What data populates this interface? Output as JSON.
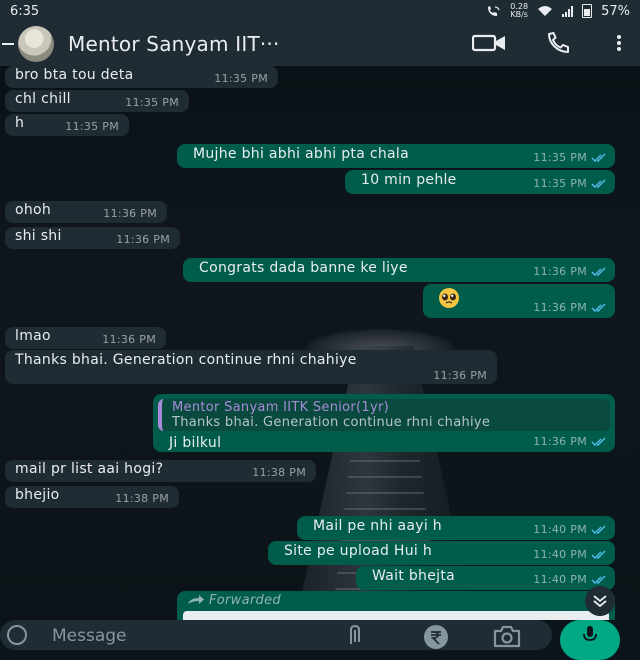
{
  "status_bar": {
    "time": "6:35",
    "net_speed_value": "0.28",
    "net_speed_unit": "KB/s",
    "battery": "57%"
  },
  "header": {
    "contact_name": "Mentor Sanyam IIT···"
  },
  "messages": [
    {
      "text": "bro bta tou deta",
      "time": "11:35 PM"
    },
    {
      "text": "chl chill",
      "time": "11:35 PM"
    },
    {
      "text": "h",
      "time": "11:35 PM"
    },
    {
      "text": "Mujhe bhi abhi abhi pta chala",
      "time": "11:35 PM"
    },
    {
      "text": "10 min pehle",
      "time": "11:35 PM"
    },
    {
      "text": "ohoh",
      "time": "11:36 PM"
    },
    {
      "text": "shi shi",
      "time": "11:36 PM"
    },
    {
      "text": "Congrats dada banne ke liye",
      "time": "11:36 PM"
    },
    {
      "text": "",
      "time": "11:36 PM"
    },
    {
      "text": "lmao",
      "time": "11:36 PM"
    },
    {
      "text": "Thanks bhai. Generation continue rhni chahiye",
      "time": "11:36 PM"
    },
    {
      "text": "Ji bilkul",
      "time": "11:36 PM",
      "quote_author": "Mentor Sanyam IITK Senior(1yr)",
      "quote_text": "Thanks bhai. Generation continue rhni chahiye"
    },
    {
      "text": "mail pr list aai hogi?",
      "time": "11:38 PM"
    },
    {
      "text": "bhejio",
      "time": "11:38 PM"
    },
    {
      "text": "Mail pe nhi aayi h",
      "time": "11:40 PM"
    },
    {
      "text": "Site pe upload Hui h",
      "time": "11:40 PM"
    },
    {
      "text": "Wait bhejta",
      "time": "11:40 PM"
    },
    {
      "forward_label": "Forwarded"
    }
  ],
  "composer": {
    "placeholder": "Message"
  },
  "colors": {
    "incoming_bubble": "#1f2c33",
    "outgoing_bubble": "#005c4b",
    "accent": "#00a884",
    "read_ticks": "#53bdeb"
  }
}
